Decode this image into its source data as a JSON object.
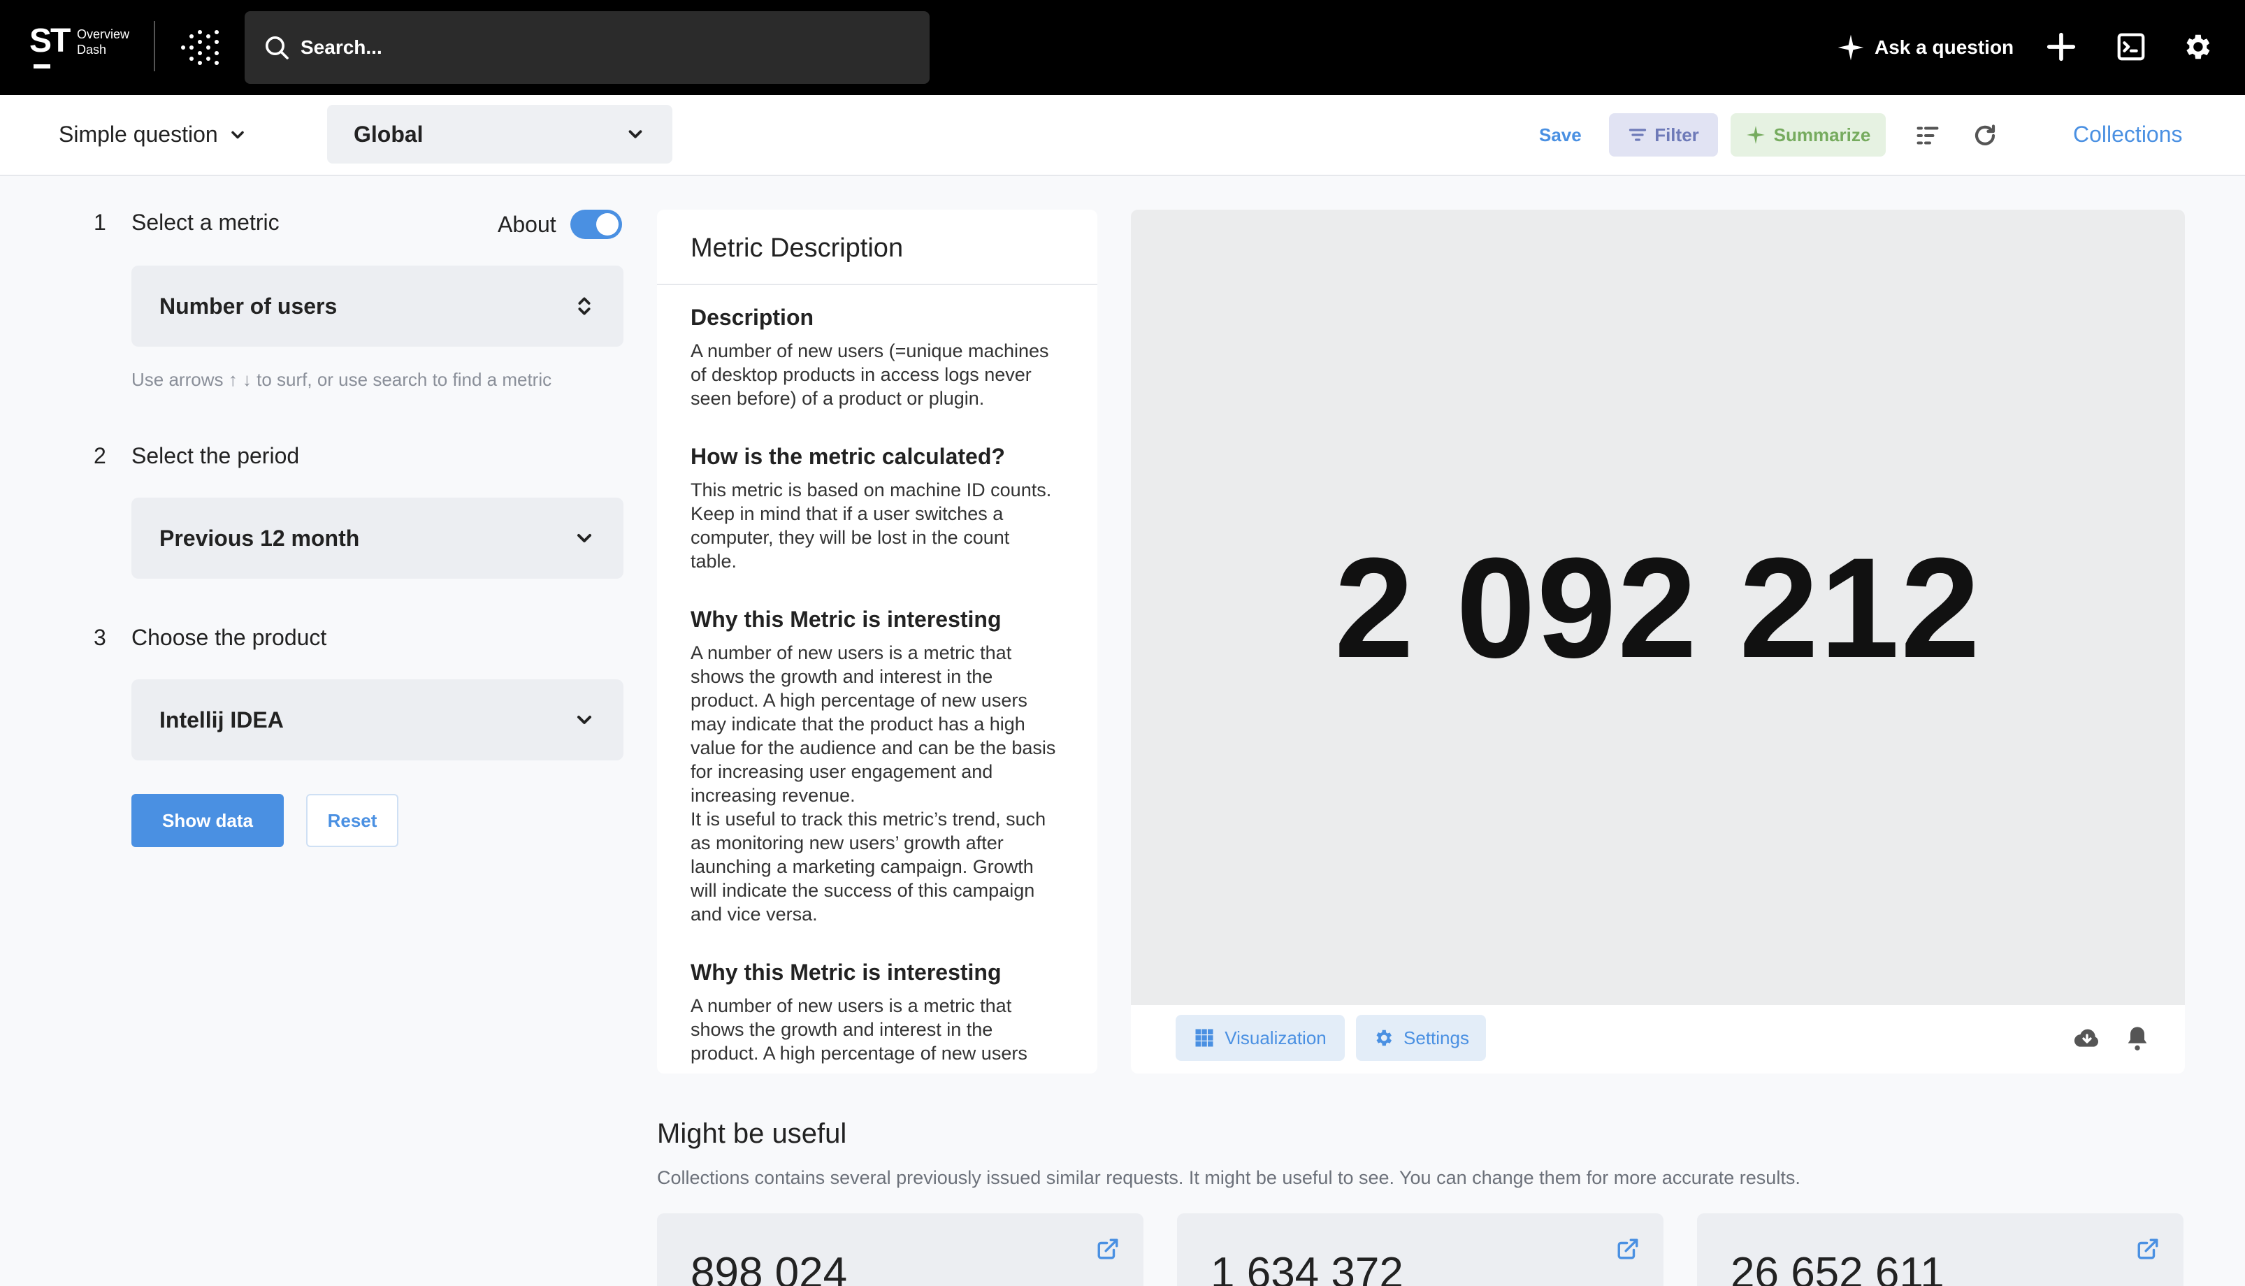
{
  "topbar": {
    "logo_main": "ST",
    "logo_line1": "Overview",
    "logo_line2": "Dash",
    "search_placeholder": "Search...",
    "ask_label": "Ask a question",
    "icons": [
      "search-icon",
      "sparkle-icon",
      "plus-icon",
      "terminal-icon",
      "gear-icon"
    ]
  },
  "toolbar": {
    "question_type": "Simple question",
    "scope": "Global",
    "save_label": "Save",
    "filter_label": "Filter",
    "summarize_label": "Summarize",
    "collections_label": "Collections",
    "colors": {
      "accent": "#4a90e2",
      "filter_bg": "#e1e3f3",
      "summarize_bg": "#e6f2e2"
    }
  },
  "steps": [
    {
      "num": "1",
      "label": "Select a metric",
      "value": "Number of users"
    },
    {
      "num": "2",
      "label": "Select the period",
      "value": "Previous 12 month"
    },
    {
      "num": "3",
      "label": "Choose the product",
      "value": "Intellij IDEA"
    }
  ],
  "about_label": "About",
  "about_enabled": true,
  "metric_hint": "Use arrows ↑ ↓ to surf, or use search to find a metric",
  "buttons": {
    "show_data": "Show data",
    "reset": "Reset"
  },
  "description": {
    "title": "Metric Description",
    "sections": [
      {
        "heading": "Description",
        "text": "A number of new users (=unique machines\nof desktop products in access logs never\nseen before) of a product or plugin."
      },
      {
        "heading": "How is the metric calculated?",
        "text": "This metric is based on machine ID counts.\nKeep in mind that if a user switches a\ncomputer, they will be lost in the count\ntable."
      },
      {
        "heading": "Why this Metric is interesting",
        "text": "A number of new users is a metric that\nshows the growth and interest in the\nproduct. A high percentage of new users\nmay indicate that the product has a high\nvalue for the audience and can be the basis\nfor increasing user engagement and\nincreasing revenue.\nIt is useful to track this metric’s trend, such\nas monitoring new users’ growth after\nlaunching a marketing campaign. Growth\nwill indicate the success of this campaign\nand vice versa."
      },
      {
        "heading": "Why this Metric is interesting",
        "text": "A number of new users is a metric that\nshows the growth and interest in the\nproduct. A high percentage of new users"
      }
    ]
  },
  "result": {
    "value": "2 092 212",
    "visualization_label": "Visualization",
    "settings_label": "Settings"
  },
  "useful": {
    "title": "Might be useful",
    "subtitle": "Collections contains several previously issued similar requests. It might be useful to see. You can change them for more accurate results.",
    "cards": [
      {
        "value": "898 024"
      },
      {
        "value": "1 634 372"
      },
      {
        "value": "26 652 611"
      }
    ]
  }
}
